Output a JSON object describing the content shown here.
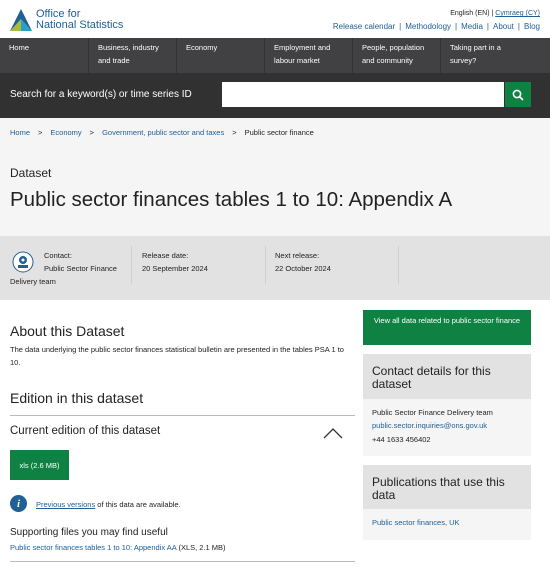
{
  "header": {
    "logo_line1": "Office for",
    "logo_line2": "National Statistics",
    "lang_current": "English (EN)",
    "lang_sep": "|",
    "lang_other": "Cymraeg (CY)",
    "top_links": [
      "Release calendar",
      "Methodology",
      "Media",
      "About",
      "Blog"
    ]
  },
  "nav": {
    "items": [
      "Home",
      "Business, industry\nand trade",
      "Economy",
      "Employment and\nlabour market",
      "People, population\nand community",
      "Taking part in a\nsurvey?"
    ]
  },
  "search": {
    "label": "Search for a keyword(s) or time series ID",
    "value": "",
    "icon": "search-icon"
  },
  "breadcrumb": {
    "items": [
      "Home",
      "Economy",
      "Government, public sector and taxes",
      "Public sector finance"
    ],
    "separator": ">"
  },
  "page": {
    "type": "Dataset",
    "title": "Public sector finances tables 1 to 10: Appendix A"
  },
  "meta": {
    "contact_label": "Contact:",
    "contact_value_line1": "Public Sector Finance",
    "contact_value_line2": "Delivery team",
    "release_label": "Release date:",
    "release_value": "20 September 2024",
    "next_label": "Next release:",
    "next_value": "22 October 2024"
  },
  "about": {
    "heading": "About this Dataset",
    "text": "The data underlying the public sector finances statistical bulletin are presented in the tables PSA 1 to 10."
  },
  "edition": {
    "heading": "Edition in this dataset",
    "current_heading": "Current edition of this dataset",
    "download_label": "xls (2.6 MB)",
    "prev_link": "Previous versions",
    "prev_rest": " of this data are available.",
    "supporting_heading": "Supporting files you may find useful",
    "supporting_link": "Public sector finances tables 1 to 10: Appendix AA",
    "supporting_meta": " (XLS, 2.1 MB)"
  },
  "sidebar": {
    "view_all": "View all data related to public sector finance",
    "contact_title": "Contact details for this dataset",
    "contact_team": "Public Sector Finance Delivery team",
    "contact_email": "public.sector.inquiries@ons.gov.uk",
    "contact_phone": "+44 1633 456402",
    "pubs_title": "Publications that use this data",
    "pubs_link": "Public sector finances, UK"
  },
  "colors": {
    "brand_blue": "#206095",
    "nav_bg": "#414042",
    "search_bg": "#323132",
    "green": "#0f8243",
    "light_gray": "#f5f5f6",
    "mid_gray": "#e2e2e3"
  }
}
